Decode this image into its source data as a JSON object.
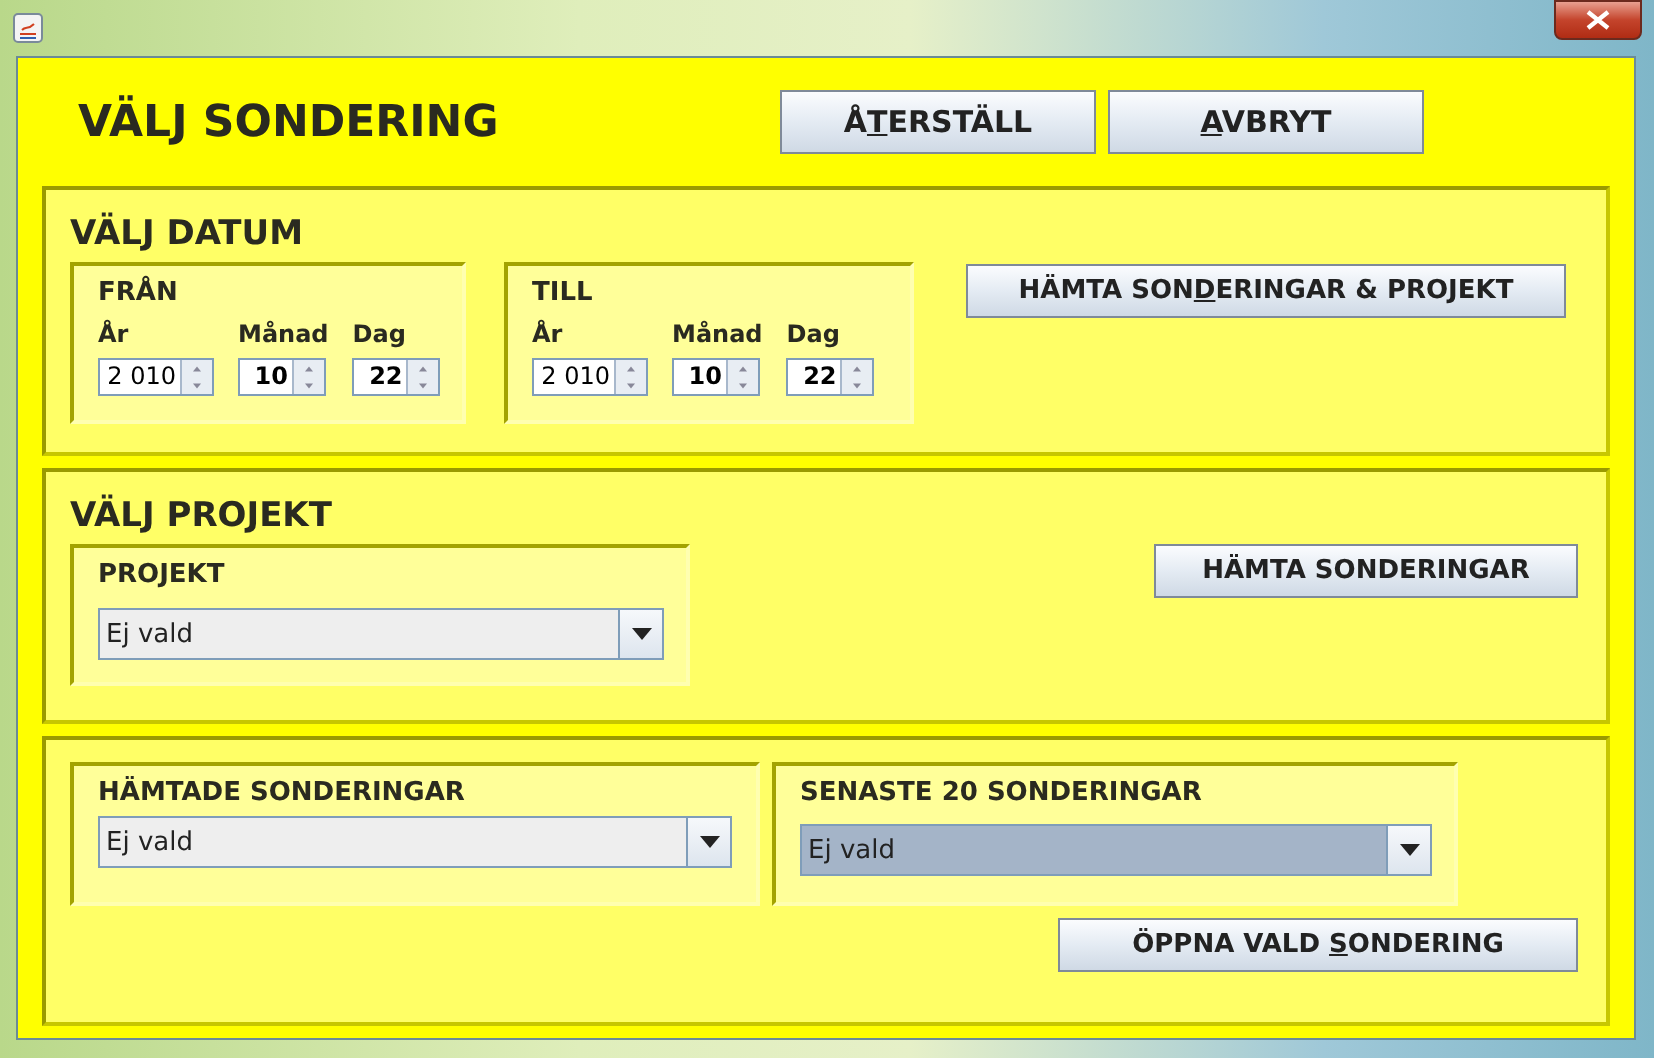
{
  "header": {
    "title": "VÄLJ SONDERING",
    "buttons": [
      {
        "before": "Å",
        "key": "T",
        "after": "ERSTÄLL"
      },
      {
        "key": "A",
        "after": "VBRYT"
      }
    ]
  },
  "date_panel": {
    "title": "VÄLJ DATUM",
    "groups": [
      {
        "title": "FRÅN",
        "fields": [
          {
            "label": "År",
            "value": "2 010",
            "kind": "year"
          },
          {
            "label": "Månad",
            "value": "10",
            "kind": "small"
          },
          {
            "label": "Dag",
            "value": "22",
            "kind": "small"
          }
        ]
      },
      {
        "title": "TILL",
        "fields": [
          {
            "label": "År",
            "value": "2 010",
            "kind": "year"
          },
          {
            "label": "Månad",
            "value": "10",
            "kind": "small"
          },
          {
            "label": "Dag",
            "value": "22",
            "kind": "small"
          }
        ]
      }
    ],
    "button": {
      "before": "HÄMTA SON",
      "key": "D",
      "after": "ERINGAR & PROJEKT"
    }
  },
  "project_panel": {
    "title": "VÄLJ PROJEKT",
    "group": {
      "title": "PROJEKT",
      "combo": {
        "value": "Ej vald",
        "focused": false
      }
    },
    "button": {
      "before": "HÄMTA SONDERINGAR"
    }
  },
  "sounding_panel": {
    "groups": [
      {
        "title": "HÄMTADE SONDERINGAR",
        "combo": {
          "value": "Ej vald",
          "focused": false
        }
      },
      {
        "title": "SENASTE 20 SONDERINGAR",
        "combo": {
          "value": "Ej vald",
          "focused": true
        }
      }
    ],
    "button": {
      "before": "ÖPPNA VALD ",
      "key": "S",
      "after": "ONDERING"
    }
  }
}
